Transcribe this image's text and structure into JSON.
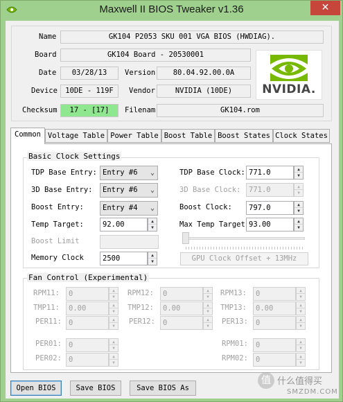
{
  "window": {
    "title": "Maxwell II BIOS Tweaker v1.36",
    "close_glyph": "✕"
  },
  "info": {
    "name_label": "Name",
    "name_value": "GK104 P2053 SKU 001 VGA BIOS (HWDIAG).",
    "board_label": "Board",
    "board_value": "GK104 Board - 20530001",
    "date_label": "Date",
    "date_value": "03/28/13",
    "version_label": "Version",
    "version_value": "80.04.92.00.0A",
    "device_label": "Device",
    "device_value": "10DE - 119F",
    "vendor_label": "Vendor",
    "vendor_value": "NVIDIA (10DE)",
    "checksum_label": "Checksum",
    "checksum_value": "17 - [17]",
    "filename_label": "Filenam",
    "filename_value": "GK104.rom",
    "logo_text": "NVIDIA."
  },
  "tabs": [
    {
      "label": "Common",
      "active": true
    },
    {
      "label": "Voltage Table"
    },
    {
      "label": "Power Table"
    },
    {
      "label": "Boost Table"
    },
    {
      "label": "Boost States"
    },
    {
      "label": "Clock States"
    }
  ],
  "basic_clock": {
    "group_title": "Basic Clock Settings",
    "tdp_base_entry_label": "TDP Base Entry:",
    "tdp_base_entry_value": "Entry #6",
    "threed_base_entry_label": "3D Base Entry:",
    "threed_base_entry_value": "Entry #6",
    "boost_entry_label": "Boost Entry:",
    "boost_entry_value": "Entry #4",
    "temp_target_label": "Temp Target:",
    "temp_target_value": "92.00",
    "boost_limit_label": "Boost Limit",
    "boost_limit_value": "",
    "memory_clock_label": "Memory Clock",
    "memory_clock_value": "2500",
    "tdp_base_clock_label": "TDP Base Clock:",
    "tdp_base_clock_value": "771.0",
    "threed_base_clock_label": "3D Base Clock:",
    "threed_base_clock_value": "771.0",
    "boost_clock_label": "Boost Clock:",
    "boost_clock_value": "797.0",
    "max_temp_target_label": "Max Temp Target:",
    "max_temp_target_value": "93.00",
    "gpu_offset_label": "GPU Clock Offset + 13MHz",
    "combo_arrow": "⌄"
  },
  "fan_control": {
    "group_title": "Fan Control (Experimental)",
    "rpm11_label": "RPM11:",
    "rpm11_value": "0",
    "rpm12_label": "RPM12:",
    "rpm12_value": "0",
    "rpm13_label": "RPM13:",
    "rpm13_value": "0",
    "tmp11_label": "TMP11:",
    "tmp11_value": "0.00",
    "tmp12_label": "TMP12:",
    "tmp12_value": "0.00",
    "tmp13_label": "TMP13:",
    "tmp13_value": "0.00",
    "per11_label": "PER11:",
    "per11_value": "0",
    "per12_label": "PER12:",
    "per12_value": "0",
    "per13_label": "PER13:",
    "per13_value": "0",
    "per01_label": "PER01:",
    "per01_value": "0",
    "per02_label": "PER02:",
    "per02_value": "0",
    "rpm01_label": "RPM01:",
    "rpm01_value": "0",
    "rpm02_label": "RPM02:",
    "rpm02_value": "0"
  },
  "buttons": {
    "open": "Open BIOS",
    "save": "Save BIOS",
    "save_as": "Save BIOS As"
  },
  "watermark": {
    "text_cn": "什么值得买",
    "text_en": "SMZDM.COM",
    "badge": "值"
  },
  "colors": {
    "window_frame": "#9fd08e",
    "checksum_ok": "#8fe88f",
    "nvidia_green": "#76b900"
  }
}
